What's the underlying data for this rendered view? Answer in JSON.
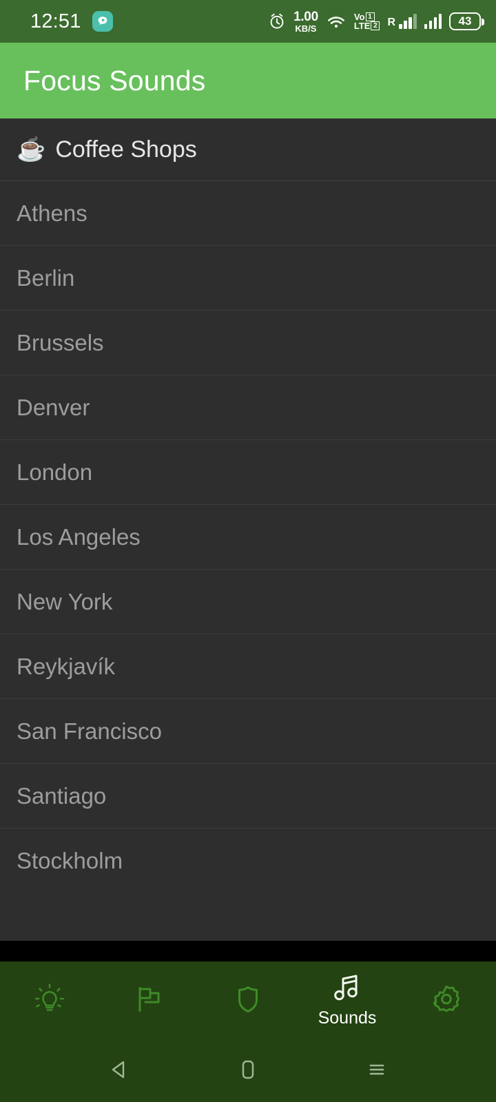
{
  "status_bar": {
    "time": "12:51",
    "notification_icon": "chat-bubble-icon",
    "alarm_icon": "alarm-clock-icon",
    "network_speed": "1.00",
    "network_speed_unit": "KB/S",
    "wifi_icon": "wifi-icon",
    "volte_top": "Vo",
    "volte_bottom": "LTE",
    "volte_sim1": "1",
    "volte_sim2": "2",
    "roaming_label": "R",
    "battery_level": "43",
    "background_color": "#3b6b2e"
  },
  "app_bar": {
    "title": "Focus Sounds",
    "background_color": "#68c05c",
    "text_color": "#ffffff"
  },
  "content": {
    "background_color": "#2e2e2e",
    "section": {
      "emoji": "☕",
      "emoji_name": "coffee-cup-icon",
      "title": "Coffee Shops"
    },
    "items": [
      {
        "label": "Athens"
      },
      {
        "label": "Berlin"
      },
      {
        "label": "Brussels"
      },
      {
        "label": "Denver"
      },
      {
        "label": "London"
      },
      {
        "label": "Los Angeles"
      },
      {
        "label": "New York"
      },
      {
        "label": "Reykjavík"
      },
      {
        "label": "San Francisco"
      },
      {
        "label": "Santiago"
      },
      {
        "label": "Stockholm"
      }
    ],
    "item_text_color": "#9d9d9d",
    "divider_color": "#3d3d3d"
  },
  "bottom_nav": {
    "background_color": "#234312",
    "active_index": 3,
    "inactive_color": "#3f8a28",
    "active_color": "#f2f7ef",
    "items": [
      {
        "icon": "lightbulb-icon",
        "label": ""
      },
      {
        "icon": "flag-icon",
        "label": ""
      },
      {
        "icon": "shield-icon",
        "label": ""
      },
      {
        "icon": "music-note-icon",
        "label": "Sounds"
      },
      {
        "icon": "gear-icon",
        "label": ""
      }
    ]
  },
  "system_nav": {
    "background_color": "#234312",
    "icon_color": "#9fb896",
    "buttons": [
      {
        "icon": "back-triangle-icon"
      },
      {
        "icon": "home-square-icon"
      },
      {
        "icon": "recents-menu-icon"
      }
    ]
  }
}
